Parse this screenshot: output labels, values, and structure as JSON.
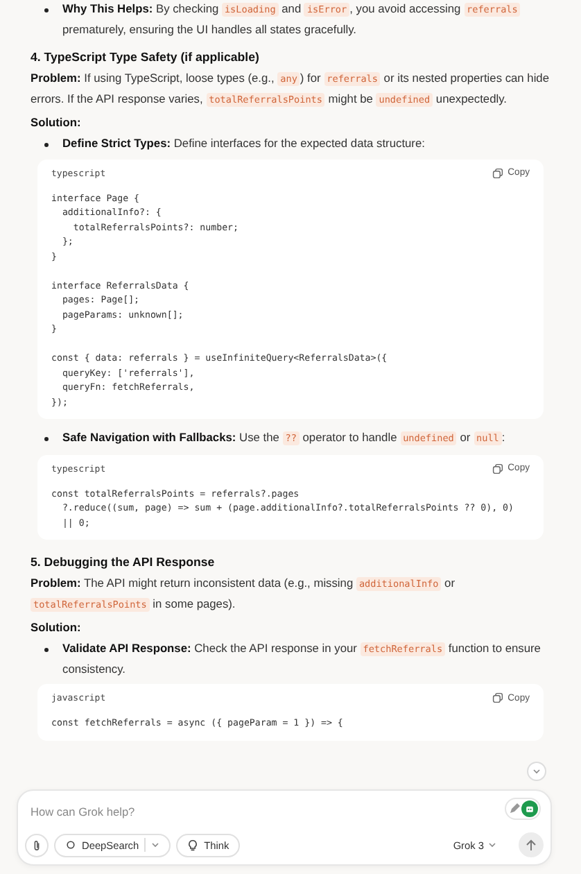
{
  "blocks": [
    {
      "kind": "bullet",
      "parts": [
        {
          "kind": "bold",
          "text": "Why This Helps:"
        },
        {
          "kind": "text",
          "text": " By checking "
        },
        {
          "kind": "code",
          "text": "isLoading"
        },
        {
          "kind": "text",
          "text": " and "
        },
        {
          "kind": "code",
          "text": "isError"
        },
        {
          "kind": "text",
          "text": ", you avoid accessing "
        },
        {
          "kind": "code",
          "text": "referrals"
        },
        {
          "kind": "text",
          "text": " prematurely, ensuring the UI handles all states gracefully."
        }
      ]
    },
    {
      "kind": "heading",
      "text": "4. TypeScript Type Safety (if applicable)"
    },
    {
      "kind": "paragraph",
      "parts": [
        {
          "kind": "bold",
          "text": "Problem:"
        },
        {
          "kind": "text",
          "text": " If using TypeScript, loose types (e.g., "
        },
        {
          "kind": "code",
          "text": "any"
        },
        {
          "kind": "text",
          "text": ") for "
        },
        {
          "kind": "code",
          "text": "referrals"
        },
        {
          "kind": "text",
          "text": " or its nested properties can hide errors. If the API response varies, "
        },
        {
          "kind": "code",
          "text": "totalReferralsPoints"
        },
        {
          "kind": "text",
          "text": " might be "
        },
        {
          "kind": "code",
          "text": "undefined"
        },
        {
          "kind": "text",
          "text": " unexpectedly."
        }
      ]
    },
    {
      "kind": "label",
      "text": "Solution:"
    },
    {
      "kind": "bullet",
      "parts": [
        {
          "kind": "bold",
          "text": "Define Strict Types:"
        },
        {
          "kind": "text",
          "text": " Define interfaces for the expected data structure:"
        }
      ]
    },
    {
      "kind": "code",
      "language": "typescript",
      "copy": "Copy",
      "groups": [
        [
          "interface Page {",
          "  additionalInfo?: {",
          "    totalReferralsPoints?: number;",
          "  };",
          "}"
        ],
        [
          "interface ReferralsData {",
          "  pages: Page[];",
          "  pageParams: unknown[];",
          "}"
        ],
        [
          "const { data: referrals } = useInfiniteQuery<ReferralsData>({",
          "  queryKey: ['referrals'],",
          "  queryFn: fetchReferrals,",
          "});"
        ]
      ]
    },
    {
      "kind": "bullet",
      "parts": [
        {
          "kind": "bold",
          "text": "Safe Navigation with Fallbacks:"
        },
        {
          "kind": "text",
          "text": " Use the "
        },
        {
          "kind": "code",
          "text": "??"
        },
        {
          "kind": "text",
          "text": " operator to handle "
        },
        {
          "kind": "code",
          "text": "undefined"
        },
        {
          "kind": "text",
          "text": " or "
        },
        {
          "kind": "code",
          "text": "null"
        },
        {
          "kind": "text",
          "text": ":"
        }
      ]
    },
    {
      "kind": "code",
      "language": "typescript",
      "copy": "Copy",
      "groups": [
        [
          "const totalReferralsPoints = referrals?.pages",
          "  ?.reduce((sum, page) => sum + (page.additionalInfo?.totalReferralsPoints ?? 0), 0)",
          "  || 0;"
        ]
      ]
    },
    {
      "kind": "heading",
      "text": "5. Debugging the API Response"
    },
    {
      "kind": "paragraph",
      "parts": [
        {
          "kind": "bold",
          "text": "Problem:"
        },
        {
          "kind": "text",
          "text": " The API might return inconsistent data (e.g., missing "
        },
        {
          "kind": "code",
          "text": "additionalInfo"
        },
        {
          "kind": "text",
          "text": " or "
        },
        {
          "kind": "code",
          "text": "totalReferralsPoints"
        },
        {
          "kind": "text",
          "text": " in some pages)."
        }
      ]
    },
    {
      "kind": "label",
      "text": "Solution:"
    },
    {
      "kind": "bullet",
      "parts": [
        {
          "kind": "bold",
          "text": "Validate API Response:"
        },
        {
          "kind": "text",
          "text": " Check the API response in your "
        },
        {
          "kind": "code",
          "text": "fetchReferrals"
        },
        {
          "kind": "text",
          "text": " function to ensure consistency."
        }
      ]
    },
    {
      "kind": "code",
      "language": "javascript",
      "copy": "Copy",
      "groups": [
        [
          "const fetchReferrals = async ({ pageParam = 1 }) => {"
        ]
      ]
    }
  ],
  "composer": {
    "toggle_on": true,
    "placeholder": "How can Grok help?",
    "tools": [
      {
        "kind": "deepsearch",
        "label": "DeepSearch"
      },
      {
        "kind": "think",
        "label": "Think"
      }
    ],
    "model": "Grok 3"
  }
}
